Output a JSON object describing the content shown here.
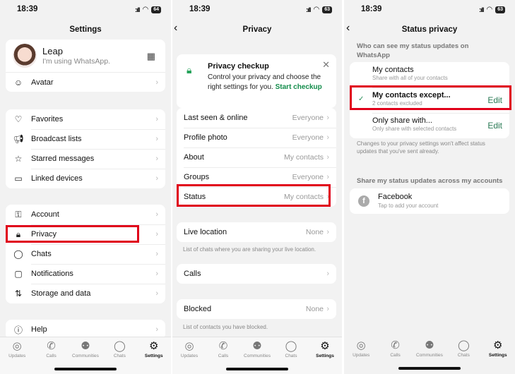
{
  "colors": {
    "accent": "#128c4a",
    "highlight": "#e0001a",
    "background": "#f2f2f2"
  },
  "statusbar": {
    "time": "18:39",
    "signal": ":ıll",
    "wifi": "wifi-icon"
  },
  "screen1": {
    "battery": "64",
    "title": "Settings",
    "profile": {
      "name": "Leap",
      "status": "I'm using WhatsApp.",
      "qr_icon": "qr-code-icon"
    },
    "avatar_row": "Avatar",
    "group1": [
      "Favorites",
      "Broadcast lists",
      "Starred messages",
      "Linked devices"
    ],
    "group2": [
      "Account",
      "Privacy",
      "Chats",
      "Notifications",
      "Storage and data"
    ],
    "help": "Help"
  },
  "screen2": {
    "battery": "63",
    "title": "Privacy",
    "checkup": {
      "title": "Privacy checkup",
      "desc": "Control your privacy and choose the right settings for you.",
      "link": "Start checkup"
    },
    "rows": [
      {
        "label": "Last seen & online",
        "value": "Everyone"
      },
      {
        "label": "Profile photo",
        "value": "Everyone"
      },
      {
        "label": "About",
        "value": "My contacts"
      },
      {
        "label": "Groups",
        "value": "Everyone"
      },
      {
        "label": "Status",
        "value": "My contacts"
      }
    ],
    "live_location": {
      "label": "Live location",
      "value": "None",
      "note": "List of chats where you are sharing your live location."
    },
    "calls": {
      "label": "Calls"
    },
    "blocked": {
      "label": "Blocked",
      "value": "None",
      "note": "List of contacts you have blocked."
    }
  },
  "screen3": {
    "battery": "63",
    "title": "Status privacy",
    "section1": "Who can see my status updates on WhatsApp",
    "options": [
      {
        "title": "My contacts",
        "sub": "Share with all of your contacts"
      },
      {
        "title": "My contacts except...",
        "sub": "2 contacts excluded",
        "edit": "Edit"
      },
      {
        "title": "Only share with...",
        "sub": "Only share with selected contacts",
        "edit": "Edit"
      }
    ],
    "note": "Changes to your privacy settings won't affect status updates that you've sent already.",
    "section2": "Share my status updates across my accounts",
    "facebook": {
      "title": "Facebook",
      "sub": "Tap to add your account"
    }
  },
  "tabbar": [
    "Updates",
    "Calls",
    "Communities",
    "Chats",
    "Settings"
  ]
}
